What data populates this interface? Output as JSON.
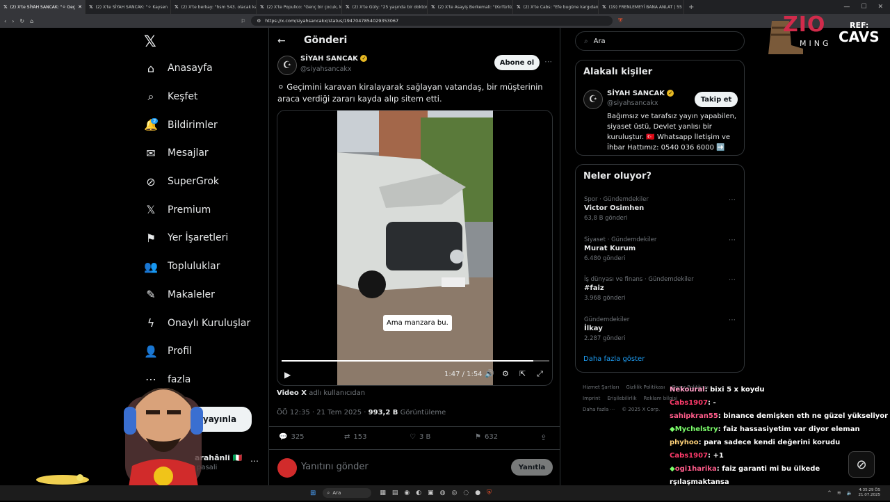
{
  "browser": {
    "tabs": [
      {
        "label": "(2) X'te SİYAH SANCAK: \"⚪ Geç",
        "active": true
      },
      {
        "label": "(2) X'te SİYAH SANCAK: \"⚪ Kaysen",
        "active": false
      },
      {
        "label": "(2) X'te berkay: \"hsm 543. olacak kad",
        "active": false
      },
      {
        "label": "(2) X'te Populico: \"Genç bir çocuk, kı",
        "active": false
      },
      {
        "label": "(2) X'te Güly: \"25 yaşında bir doktor",
        "active": false
      },
      {
        "label": "(2) X'te Asayiş Berkemali: \"(Kırfürlü)",
        "active": false
      },
      {
        "label": "(2) X'te Cabs: \"Efe bugüne kargıdan k",
        "active": false
      },
      {
        "label": "(19) FRENLEMEYİ BANA ANLAT | 55",
        "active": false
      }
    ],
    "url": "https://x.com/siyahsancakx/status/1947047854029353067"
  },
  "sidebar": {
    "items": [
      {
        "label": "Anasayfa",
        "icon": "home-icon",
        "glyph": "⌂"
      },
      {
        "label": "Keşfet",
        "icon": "search-icon",
        "glyph": "⌕"
      },
      {
        "label": "Bildirimler",
        "icon": "bell-icon",
        "glyph": "🔔",
        "badge": "2"
      },
      {
        "label": "Mesajlar",
        "icon": "mail-icon",
        "glyph": "✉"
      },
      {
        "label": "SuperGrok",
        "icon": "grok-icon",
        "glyph": "⊘"
      },
      {
        "label": "Premium",
        "icon": "x-premium-icon",
        "glyph": "𝕏"
      },
      {
        "label": "Yer İşaretleri",
        "icon": "bookmark-icon",
        "glyph": "⚑"
      },
      {
        "label": "Topluluklar",
        "icon": "communities-icon",
        "glyph": "👥"
      },
      {
        "label": "Makaleler",
        "icon": "articles-icon",
        "glyph": "✎"
      },
      {
        "label": "Onaylı Kuruluşlar",
        "icon": "lightning-icon",
        "glyph": "ϟ"
      },
      {
        "label": "Profil",
        "icon": "profile-icon",
        "glyph": "👤"
      },
      {
        "label": "fazla",
        "icon": "more-icon",
        "glyph": "⋯"
      }
    ],
    "post_button": "yayınla",
    "account_name": "arahânli 🇮🇹",
    "account_handle": "pasali"
  },
  "main": {
    "header_title": "Gönderi",
    "author_name": "SİYAH SANCAK",
    "author_handle": "@siyahsancakx",
    "subscribe_label": "Abone ol",
    "tweet_text": "⚪ Geçimini karavan kiralayarak sağlayan vatandaş, bir müşterinin araca verdiği zararı kayda alıp sitem etti.",
    "video_caption": "Ama manzara bu.",
    "video_time": "1:47 / 1:54",
    "video_progress": 0.94,
    "video_credit_name": "Video X",
    "video_credit_rest": "adlı kullanıcıdan",
    "timestamp": "ÖÖ 12:35 · 21 Tem 2025 ·",
    "views_count": "993,2 B",
    "views_label": "Görüntüleme",
    "stats": {
      "replies": "325",
      "reposts": "153",
      "likes": "3 B",
      "bookmarks": "632"
    },
    "reply_placeholder": "Yanıtını gönder",
    "reply_button": "Yanıtla"
  },
  "right": {
    "search_placeholder": "Ara",
    "related_title": "Alakalı kişiler",
    "related_name": "SİYAH SANCAK",
    "related_handle": "@siyahsancakx",
    "follow_label": "Takip et",
    "related_bio": "Bağımsız ve tarafsız yayın yapabilen, siyaset üstü, Devlet yanlısı bir kuruluştur. 🇹🇷 Whatsapp İletişim ve İhbar Hattımız: 0540 036 6000 ➡️",
    "trends_title": "Neler oluyor?",
    "trends": [
      {
        "category": "Spor · Gündemdekiler",
        "name": "Victor Osimhen",
        "count": "63,8 B gönderi"
      },
      {
        "category": "Siyaset · Gündemdekiler",
        "name": "Murat Kurum",
        "count": "6.480 gönderi"
      },
      {
        "category": "İş dünyası ve finans · Gündemdekiler",
        "name": "#faiz",
        "count": "3.968 gönderi"
      },
      {
        "category": "Gündemdekiler",
        "name": "İlkay",
        "count": "2.287 gönderi"
      }
    ],
    "show_more": "Daha fazla göster",
    "footer": [
      "Hizmet Şartları",
      "Gizlilik Politikası",
      "Çerez Politikası",
      "Imprint",
      "Erişilebilirlik",
      "Reklam bilgisi",
      "Daha fazla ···",
      "© 2025 X Corp."
    ]
  },
  "overlay": {
    "brand_top": "ZIO",
    "brand_bottom": "MING",
    "ref_label": "REF:",
    "ref_name": "CAVS",
    "chat": [
      {
        "user": "Nekoural",
        "msg": ": bixi 5 x koydu",
        "cls": "u1",
        "mark": ""
      },
      {
        "user": "Cabs1907",
        "msg": ": -",
        "cls": "u2",
        "mark": ""
      },
      {
        "user": "sahipkran55",
        "msg": ": binance demişken eth ne güzel yükseliyor ya",
        "cls": "u3",
        "mark": ""
      },
      {
        "user": "Mychelstry",
        "msg": ": faiz hassasiyetim var diyor eleman",
        "cls": "u4",
        "mark": "◆"
      },
      {
        "user": "phyhoo",
        "msg": ": para sadece kendi değerini korudu",
        "cls": "u5",
        "mark": ""
      },
      {
        "user": "Cabs1907",
        "msg": ": +1",
        "cls": "u2",
        "mark": ""
      },
      {
        "user": "ogi1harika",
        "msg": ": faiz garanti mi bu ülkede",
        "cls": "u3",
        "mark": "◆"
      },
      {
        "user": "",
        "msg": "rşılaşmaktansa",
        "cls": "u1",
        "mark": ""
      }
    ]
  },
  "taskbar": {
    "search": "Ara",
    "time": "4:35:29 ÖS",
    "date": "21.07.2025"
  },
  "colors": {
    "accent": "#1d9bf0",
    "background": "#000000",
    "border": "#2f3336",
    "verified": "#e8b923"
  }
}
